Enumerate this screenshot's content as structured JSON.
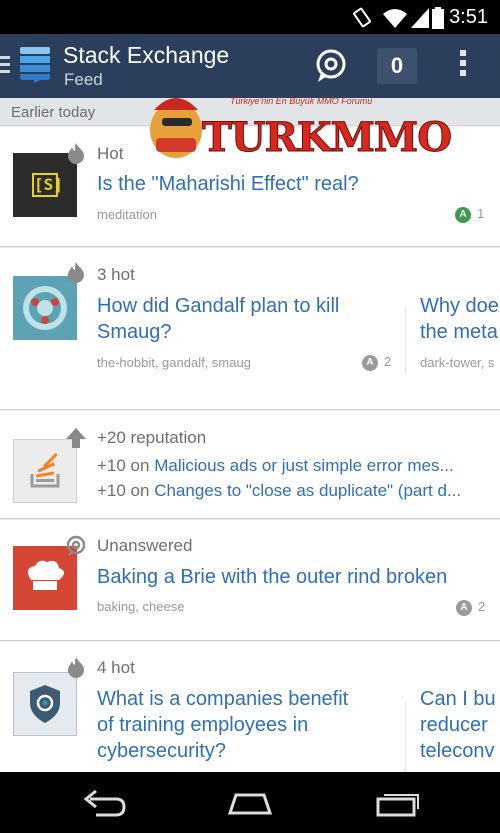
{
  "status_bar": {
    "time": "3:51"
  },
  "action_bar": {
    "title": "Stack Exchange",
    "subtitle": "Feed",
    "inbox_count": "0"
  },
  "section": {
    "label": "Earlier today"
  },
  "watermark": {
    "tagline": "Türkiye'nin En Büyük MMO Forumu",
    "wordmark": "TURKMMO"
  },
  "cards": [
    {
      "kind": "Hot",
      "title": "Is the \"Maharishi Effect\" real?",
      "tags": "meditation",
      "answers": "1",
      "answer_color": "#3b9b50",
      "thumb_text": "[S]"
    },
    {
      "kind": "3 hot",
      "title_line1": "How did Gandalf plan to kill",
      "title_line2": "Smaug?",
      "tags": "the-hobbit, gandalf, smaug",
      "answers": "2",
      "answer_color": "#9a9a9a",
      "side_title_line1": "Why doe",
      "side_title_line2": "the meta",
      "side_tags": "dark-tower, s"
    },
    {
      "kind": "+20 reputation",
      "rep1_prefix": "+10 on ",
      "rep1_link": "Malicious ads or just simple error mes...",
      "rep2_prefix": "+10 on ",
      "rep2_link": "Changes to \"close as duplicate\" (part d..."
    },
    {
      "kind": "Unanswered",
      "title": "Baking a Brie with the outer rind broken",
      "tags": "baking, cheese",
      "answers": "2",
      "answer_color": "#9a9a9a"
    },
    {
      "kind": "4 hot",
      "title_line1": "What is a companies benefit",
      "title_line2": "of training employees in",
      "title_line3": "cybersecurity?",
      "side_title_line1": "Can I bu",
      "side_title_line2": "reducer",
      "side_title_line3": "teleconv"
    }
  ],
  "colors": {
    "action_bar": "#2b3f5c",
    "link": "#2f6fb7",
    "hot_icon": "#8a8a8a"
  }
}
